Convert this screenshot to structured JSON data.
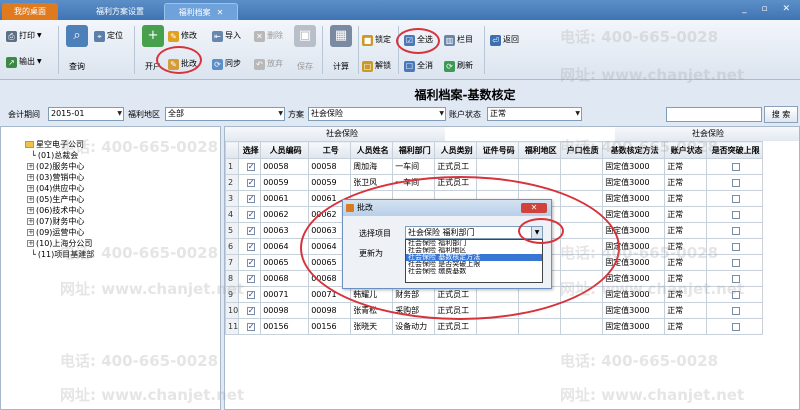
{
  "tabs": [
    {
      "label": "我的桌面"
    },
    {
      "label": "福利方案设置"
    },
    {
      "label": "福利档案",
      "close": "✕"
    }
  ],
  "window_buttons": "_ ▫ ✕",
  "toolbar": {
    "print": "打印",
    "export": "输出",
    "query": "查询",
    "locate": "定位",
    "open_account": "开户",
    "modify": "修改",
    "import": "导入",
    "delete": "删除",
    "batch_edit": "批改",
    "sync": "同步",
    "abandon": "放弃",
    "save": "保存",
    "calculate": "计算",
    "lock": "锁定",
    "unlock": "解锁",
    "select_all": "全选",
    "deselect_all": "全消",
    "columns": "栏目",
    "refresh": "刷新",
    "return": "返回"
  },
  "page_title": "福利档案-基数核定",
  "filters": {
    "period_label": "会计期间",
    "period_value": "2015-01",
    "region_label": "福利地区",
    "region_value": "全部",
    "plan_label": "方案",
    "plan_value": "社会保险",
    "account_status_label": "账户状态",
    "account_status_value": "正常",
    "search_button": "搜 索"
  },
  "tree": {
    "root": "星空电子公司",
    "items": [
      "(01)总裁会",
      "(02)服务中心",
      "(03)营销中心",
      "(04)供应中心",
      "(05)生产中心",
      "(06)技术中心",
      "(07)财务中心",
      "(09)运营中心",
      "(10)上海分公司",
      "(11)项目基建部"
    ]
  },
  "grid": {
    "group_header": "社会保险",
    "group_header_right": "社会保险",
    "columns": [
      "选择",
      "人员编码",
      "工号",
      "人员姓名",
      "福利部门",
      "人员类别",
      "证件号码",
      "福利地区",
      "户口性质",
      "基数核定方法",
      "账户状态",
      "是否突破上限"
    ],
    "rows": [
      {
        "no": "1",
        "code": "00058",
        "job": "00058",
        "name": "周加海",
        "dept": "一车间",
        "type": "正式员工",
        "method": "固定值3000",
        "status": "正常"
      },
      {
        "no": "2",
        "code": "00059",
        "job": "00059",
        "name": "张卫风",
        "dept": "一车间",
        "type": "正式员工",
        "method": "固定值3000",
        "status": "正常"
      },
      {
        "no": "3",
        "code": "00061",
        "job": "00061",
        "name": "",
        "dept": "",
        "type": "",
        "method": "固定值3000",
        "status": "正常"
      },
      {
        "no": "4",
        "code": "00062",
        "job": "00062",
        "name": "",
        "dept": "",
        "type": "",
        "method": "固定值3000",
        "status": "正常"
      },
      {
        "no": "5",
        "code": "00063",
        "job": "00063",
        "name": "",
        "dept": "",
        "type": "",
        "method": "固定值3000",
        "status": "正常"
      },
      {
        "no": "6",
        "code": "00064",
        "job": "00064",
        "name": "",
        "dept": "",
        "type": "",
        "method": "固定值3000",
        "status": "正常"
      },
      {
        "no": "7",
        "code": "00065",
        "job": "00065",
        "name": "",
        "dept": "",
        "type": "",
        "method": "固定值3000",
        "status": "正常"
      },
      {
        "no": "8",
        "code": "00068",
        "job": "00068",
        "name": "",
        "dept": "",
        "type": "",
        "method": "固定值3000",
        "status": "正常"
      },
      {
        "no": "9",
        "code": "00071",
        "job": "00071",
        "name": "韩耀儿",
        "dept": "财务部",
        "type": "正式员工",
        "method": "固定值3000",
        "status": "正常"
      },
      {
        "no": "10",
        "code": "00098",
        "job": "00098",
        "name": "张青松",
        "dept": "采购部",
        "type": "正式员工",
        "method": "固定值3000",
        "status": "正常"
      },
      {
        "no": "11",
        "code": "00156",
        "job": "00156",
        "name": "张晓天",
        "dept": "设备动力",
        "type": "正式员工",
        "method": "固定值3000",
        "status": "正常"
      }
    ]
  },
  "dialog": {
    "title": "批改",
    "select_item_label": "选择项目",
    "select_item_value": "社会保险 福利部门",
    "update_to_label": "更新为",
    "options": [
      "社会保险 福利部门",
      "社会保险 福利地区",
      "社会保险 基数核定方法",
      "社会保险 是否突破上限",
      "社会保险 缴费基数"
    ],
    "selected_index": 2
  },
  "watermark": {
    "phone": "电话: 400-665-0028",
    "site": "网址: www.chanjet.net"
  },
  "colors": {
    "accent": "#3f74b3",
    "home_tab": "#e07a1f",
    "highlight_circle": "#d8323a"
  }
}
